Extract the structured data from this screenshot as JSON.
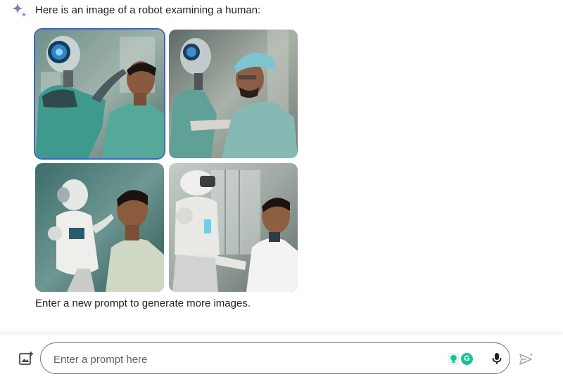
{
  "response": {
    "intro_text": "Here is an image of a robot examining a human:",
    "images": [
      {
        "alt": "Robot with glowing visor examining a man in teal scrubs",
        "selected": true
      },
      {
        "alt": "Robot in teal gown touching a surgeon in a cap"
      },
      {
        "alt": "White humanoid robot holding a man's chin"
      },
      {
        "alt": "White robot examining a doctor in a lab coat"
      }
    ],
    "followup_text": "Enter a new prompt to generate more images."
  },
  "prompt": {
    "placeholder": "Enter a prompt here",
    "value": ""
  },
  "icons": {
    "assistant": "sparkle-icon",
    "upload": "add-image-icon",
    "extension_1": "bulb-icon",
    "extension_2": "grammarly-icon",
    "mic": "microphone-icon",
    "send": "send-icon"
  },
  "extension_g_label": "G",
  "colors": {
    "selection": "#3b67c7",
    "extension_green": "#15c39a",
    "spark_blue": "#4a7bd6",
    "spark_red": "#c97582"
  }
}
